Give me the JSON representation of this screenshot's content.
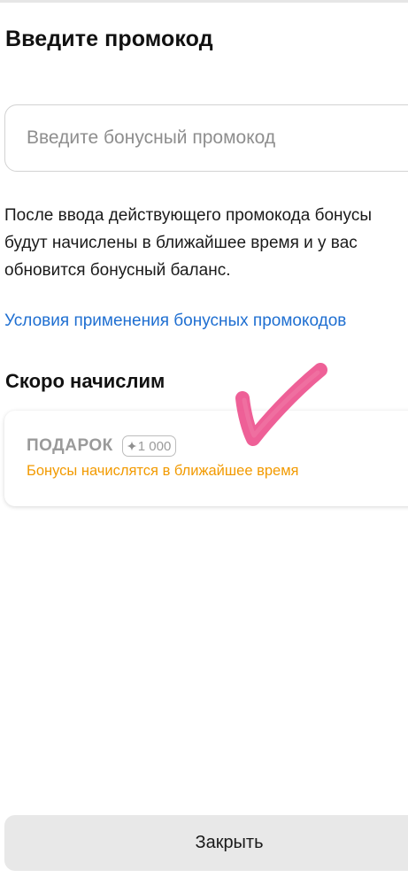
{
  "header": {
    "title": "Введите промокод"
  },
  "promo_field": {
    "placeholder": "Введите бонусный промокод",
    "value": ""
  },
  "info": {
    "lines": [
      "После ввода действующего промокода бонусы",
      "будут начислены в ближайшее время и у вас",
      "обновится бонусный баланс."
    ]
  },
  "terms_link": {
    "label": "Условия применения бонусных промокодов"
  },
  "pending_section": {
    "title": "Скоро начислим",
    "items": [
      {
        "name": "ПОДАРОК",
        "amount_icon": "sparkle-icon",
        "amount": "1 000",
        "status": "Бонусы начислятся в ближайшее время"
      }
    ]
  },
  "footer": {
    "close_label": "Закрыть"
  },
  "colors": {
    "link": "#1f6fd1",
    "status": "#f29a00",
    "muted_text": "#9a9a9a",
    "button_bg": "#e8e8e8",
    "checkmark": "#ec4f8c"
  },
  "annotations": {
    "checkmark_icon": "checkmark-icon"
  }
}
